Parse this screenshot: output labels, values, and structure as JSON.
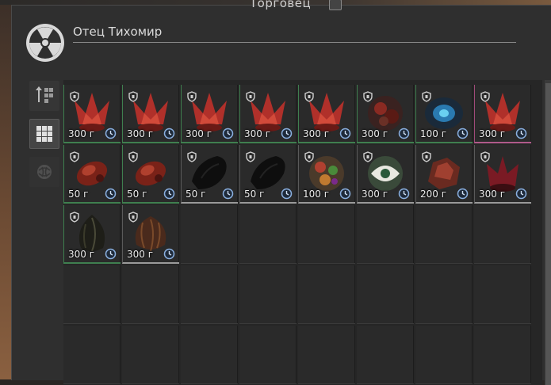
{
  "window": {
    "title": "Торговец"
  },
  "npc": {
    "name": "Отец Тихомир",
    "icon": "radiation-icon"
  },
  "tabs": [
    {
      "name": "sort-icon",
      "active": false
    },
    {
      "name": "grid-view-icon",
      "active": true
    },
    {
      "name": "artifact-filter-icon",
      "active": false
    }
  ],
  "items": [
    {
      "price": "300 г",
      "kind": "red-crystal",
      "rarity": "green"
    },
    {
      "price": "300 г",
      "kind": "red-crystal",
      "rarity": "green"
    },
    {
      "price": "300 г",
      "kind": "red-crystal",
      "rarity": "green"
    },
    {
      "price": "300 г",
      "kind": "red-crystal",
      "rarity": "green"
    },
    {
      "price": "300 г",
      "kind": "red-crystal",
      "rarity": "green"
    },
    {
      "price": "300 г",
      "kind": "dark-red-orb",
      "rarity": "green"
    },
    {
      "price": "100 г",
      "kind": "blue-orb",
      "rarity": "green"
    },
    {
      "price": "300 г",
      "kind": "red-crystal",
      "rarity": "pink"
    },
    {
      "price": "50 г",
      "kind": "red-lump",
      "rarity": "green"
    },
    {
      "price": "50 г",
      "kind": "red-lump",
      "rarity": "green"
    },
    {
      "price": "50 г",
      "kind": "black-stone",
      "rarity": "gray"
    },
    {
      "price": "50 г",
      "kind": "black-stone",
      "rarity": "gray"
    },
    {
      "price": "100 г",
      "kind": "multicolor-orb",
      "rarity": "gray"
    },
    {
      "price": "300 г",
      "kind": "green-orb",
      "rarity": "gray"
    },
    {
      "price": "200 г",
      "kind": "red-rock",
      "rarity": "gray"
    },
    {
      "price": "300 г",
      "kind": "dark-red-crystal",
      "rarity": "gray"
    },
    {
      "price": "300 г",
      "kind": "dark-shell",
      "rarity": "green"
    },
    {
      "price": "300 г",
      "kind": "brown-shell",
      "rarity": "gray"
    }
  ],
  "colors": {
    "common": "#9a9a9a",
    "uncommon": "#3f7f4f",
    "rare": "#b05a8a"
  }
}
